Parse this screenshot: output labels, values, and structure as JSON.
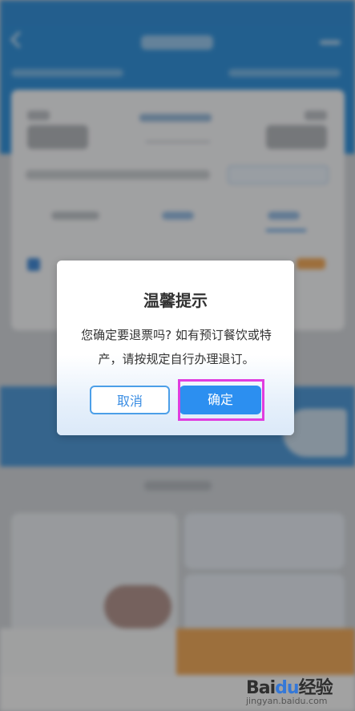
{
  "dialog": {
    "title": "温馨提示",
    "message": "您确定要退票吗? 如有预订餐饮或特产，请按规定自行办理退订。",
    "cancel_label": "取消",
    "confirm_label": "确定"
  },
  "watermark": {
    "logo_left": "Bai",
    "logo_paw": "du",
    "logo_right": "经验",
    "url": "jingyan.baidu.com"
  },
  "colors": {
    "header_blue": "#1e87d8",
    "confirm_button": "#2c8ff0",
    "highlight": "#e03ddf",
    "bottom_orange": "#f0a24b"
  },
  "icons": {
    "back": "back-arrow-icon",
    "more": "more-dots-icon",
    "paw": "baidu-paw-icon"
  }
}
